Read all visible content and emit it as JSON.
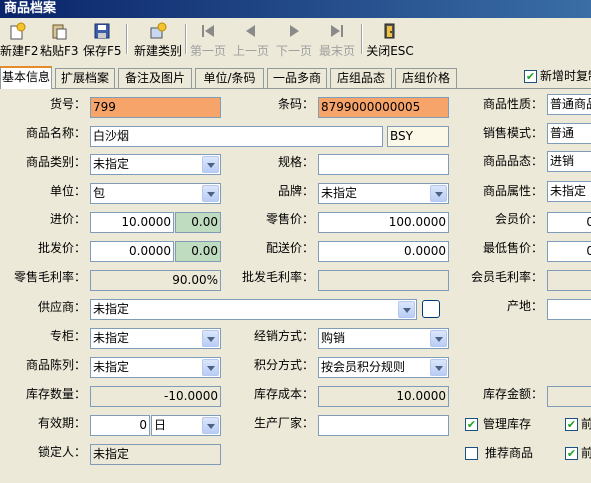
{
  "window": {
    "title": "商品档案"
  },
  "toolbar": {
    "new": "新建F2",
    "paste": "粘贴F3",
    "save": "保存F5",
    "new_category": "新建类别",
    "first": "第一页",
    "prev": "上一页",
    "next": "下一页",
    "last": "最末页",
    "close": "关闭ESC"
  },
  "tabs": [
    "基本信息",
    "扩展档案",
    "备注及图片",
    "单位/条码",
    "一品多商",
    "店组品态",
    "店组价格"
  ],
  "copy_checkbox": "新增时复制",
  "form": {
    "goods_no_label": "货号：",
    "goods_no": "799",
    "barcode_label": "条码：",
    "barcode": "8799000000005",
    "nature_label": "商品性质：",
    "nature": "普通商品",
    "name_label": "商品名称：",
    "name": "白沙烟",
    "name_code": "BSY",
    "sale_mode_label": "销售模式：",
    "sale_mode": "普通",
    "category_label": "商品类别：",
    "category": "未指定",
    "spec_label": "规格：",
    "spec": "",
    "status_label": "商品品态：",
    "status": "进销",
    "unit_label": "单位：",
    "unit": "包",
    "brand_label": "品牌：",
    "brand": "未指定",
    "attr_label": "商品属性：",
    "attr": "未指定",
    "cost_label": "进价：",
    "cost": "10.0000",
    "cost2": "0.00",
    "retail_label": "零售价：",
    "retail": "100.0000",
    "member_price_label": "会员价：",
    "member_price": "0",
    "wholesale_label": "批发价：",
    "wholesale": "0.0000",
    "wholesale2": "0.00",
    "delivery_label": "配送价：",
    "delivery": "0.0000",
    "min_price_label": "最低售价：",
    "min_price": "0",
    "retail_margin_label": "零售毛利率：",
    "retail_margin": "90.00%",
    "wholesale_margin_label": "批发毛利率：",
    "wholesale_margin": "",
    "member_margin_label": "会员毛利率：",
    "member_margin": "",
    "supplier_label": "供应商：",
    "supplier": "未指定",
    "origin_label": "产地：",
    "origin": "",
    "counter_label": "专柜：",
    "counter": "未指定",
    "biz_mode_label": "经销方式：",
    "biz_mode": "购销",
    "display_label": "商品陈列：",
    "display": "未指定",
    "points_label": "积分方式：",
    "points": "按会员积分规则",
    "stock_qty_label": "库存数量：",
    "stock_qty": "-10.0000",
    "stock_cost_label": "库存成本：",
    "stock_cost": "10.0000",
    "stock_amt_label": "库存金额：",
    "stock_amt": "",
    "expiry_label": "有效期：",
    "expiry": "0",
    "expiry_unit": "日",
    "maker_label": "生产厂家：",
    "maker": "",
    "manage_stock_label": "管理库存",
    "recommend_label": "推荐商品",
    "front1_label": "前",
    "front2_label": "前",
    "locker_label": "锁定人：",
    "locker": "未指定"
  }
}
